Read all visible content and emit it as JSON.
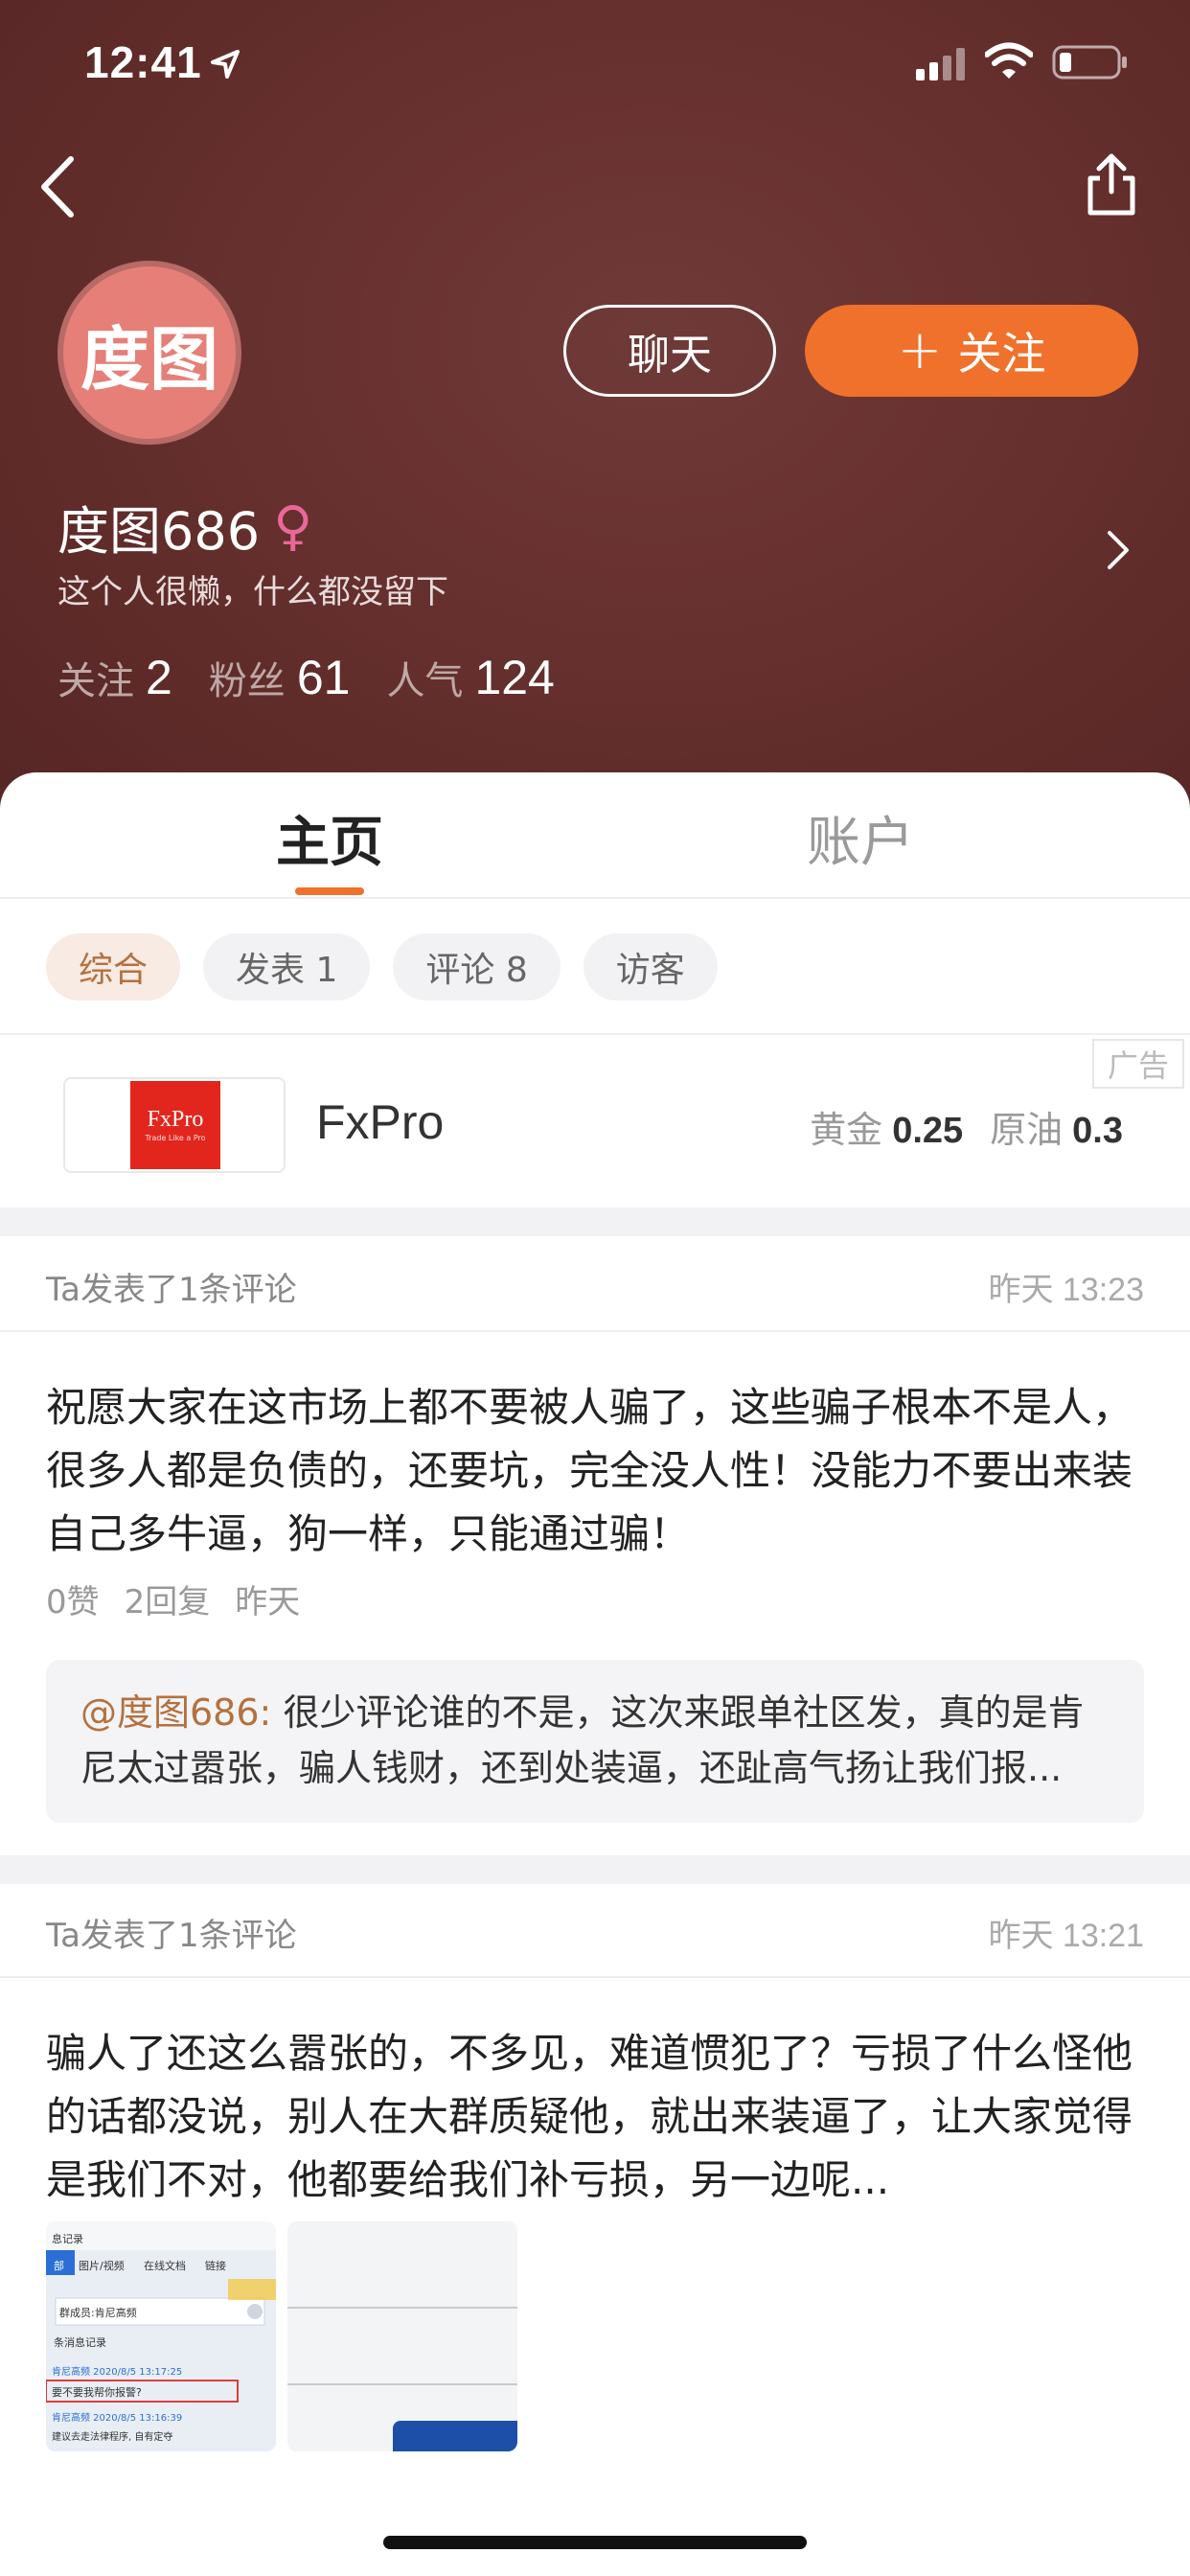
{
  "status_bar": {
    "time": "12:41"
  },
  "profile": {
    "avatar_text": "度图",
    "name": "度图686",
    "gender_symbol": "♀",
    "bio": "这个人很懒，什么都没留下",
    "chat_label": "聊天",
    "follow_label": "关注",
    "follow_plus": "+",
    "stats": [
      {
        "label": "关注",
        "value": "2"
      },
      {
        "label": "粉丝",
        "value": "61"
      },
      {
        "label": "人气",
        "value": "124"
      }
    ]
  },
  "tabs": [
    {
      "label": "主页",
      "active": true
    },
    {
      "label": "账户",
      "active": false
    }
  ],
  "filters": [
    {
      "label": "综合",
      "active": true
    },
    {
      "label": "发表 1",
      "active": false
    },
    {
      "label": "评论 8",
      "active": false
    },
    {
      "label": "访客",
      "active": false
    }
  ],
  "ad": {
    "tag": "广告",
    "logo_text": "FxPro",
    "logo_subtext": "Trade Like a Pro",
    "name": "FxPro",
    "prices": [
      {
        "label": "黄金",
        "value": "0.25"
      },
      {
        "label": "原油",
        "value": "0.3"
      }
    ]
  },
  "posts": [
    {
      "header": "Ta发表了1条评论",
      "time": "昨天 13:23",
      "body": "祝愿大家在这市场上都不要被人骗了，这些骗子根本不是人，很多人都是负债的，还要坑，完全没人性！没能力不要出来装自己多牛逼，狗一样，只能通过骗！",
      "likes": "0赞",
      "replies": "2回复",
      "date": "昨天",
      "quote_user": "@度图686:",
      "quote_text": "很少评论谁的不是，这次来跟单社区发，真的是肯尼太过嚣张，骗人钱财，还到处装逼，还趾高气扬让我们报..."
    },
    {
      "header": "Ta发表了1条评论",
      "time": "昨天 13:21",
      "body": "骗人了还这么嚣张的，不多见，难道惯犯了？亏损了什么怪他的话都没说，别人在大群质疑他，就出来装逼了，让大家觉得是我们不对，他都要给我们补亏损，另一边呢..."
    }
  ],
  "thumbnail": {
    "title": "息记录",
    "tab_all": "部",
    "tab_media": "图片/视频",
    "tab_docs": "在线文档",
    "tab_links": "链接",
    "search_text": "群成员:肯尼高频",
    "count_text": "条消息记录",
    "msg1_time": "肯尼高频 2020/8/5 13:17:25",
    "msg1_text": "要不要我帮你报警?",
    "msg2_time": "肯尼高频 2020/8/5 13:16:39",
    "msg2_text": "建议去走法律程序, 自有定夺"
  },
  "colors": {
    "header_bg": "#6a3331",
    "accent": "#f0712b",
    "avatar_bg": "#e57f78",
    "quote_user": "#b3713f"
  }
}
